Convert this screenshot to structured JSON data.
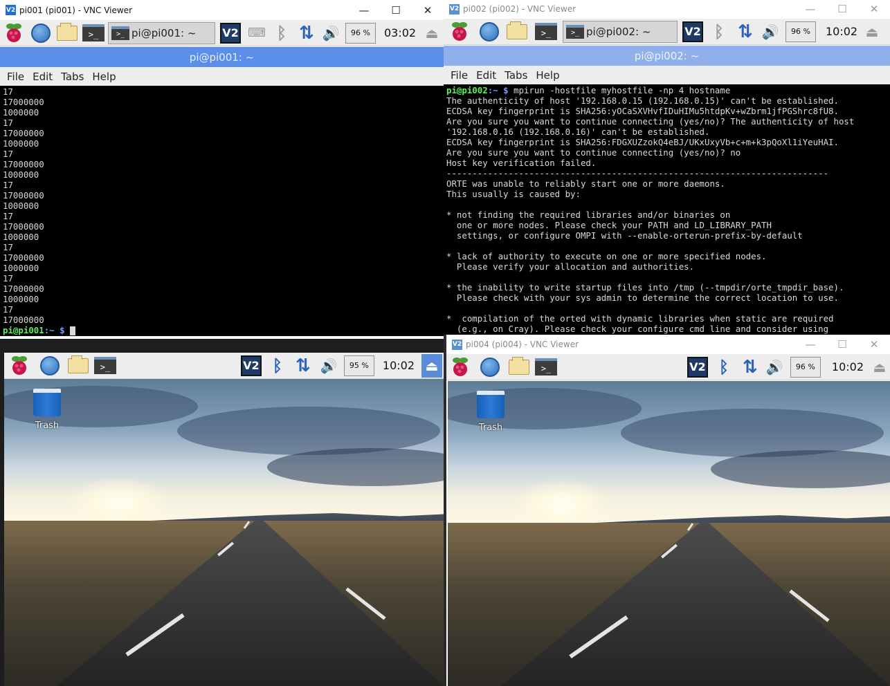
{
  "pi001": {
    "window_title": "pi001 (pi001) - VNC Viewer",
    "taskbar_label": "pi@pi001: ~",
    "cpu": "96 %",
    "clock": "03:02",
    "term_title": "pi@pi001: ~",
    "menu": [
      "File",
      "Edit",
      "Tabs",
      "Help"
    ],
    "lines": [
      "17",
      "17000000",
      "1000000",
      "17",
      "17000000",
      "1000000",
      "17",
      "17000000",
      "1000000",
      "17",
      "17000000",
      "1000000",
      "17",
      "17000000",
      "1000000",
      "17",
      "17000000",
      "1000000",
      "17",
      "17000000",
      "1000000",
      "17",
      "17000000"
    ],
    "prompt_user": "pi@pi001",
    "prompt_path": ":~ $ "
  },
  "pi002": {
    "window_title": "pi002 (pi002) - VNC Viewer",
    "taskbar_label": "pi@pi002: ~",
    "cpu": "96 %",
    "clock": "10:02",
    "term_title": "pi@pi002: ~",
    "menu": [
      "File",
      "Edit",
      "Tabs",
      "Help"
    ],
    "prompt_user": "pi@pi002",
    "prompt_path": ":~ $ ",
    "command": "mpirun -hostfile myhostfile -np 4 hostname",
    "lines": [
      "The authenticity of host '192.168.0.15 (192.168.0.15)' can't be established.",
      "ECDSA key fingerprint is SHA256:yOCaSXVHvfIDuHIMu5htdpKv+wZbrm1jfPGShrc8fU8.",
      "Are you sure you want to continue connecting (yes/no)? The authenticity of host",
      "'192.168.0.16 (192.168.0.16)' can't be established.",
      "ECDSA key fingerprint is SHA256:FDGXUZzokQ4eBJ/UKxUxyVb+c+m+k3pQoXl1iYeuHAI.",
      "Are you sure you want to continue connecting (yes/no)? no",
      "Host key verification failed.",
      "--------------------------------------------------------------------------",
      "ORTE was unable to reliably start one or more daemons.",
      "This usually is caused by:",
      "",
      "* not finding the required libraries and/or binaries on",
      "  one or more nodes. Please check your PATH and LD_LIBRARY_PATH",
      "  settings, or configure OMPI with --enable-orterun-prefix-by-default",
      "",
      "* lack of authority to execute on one or more specified nodes.",
      "  Please verify your allocation and authorities.",
      "",
      "* the inability to write startup files into /tmp (--tmpdir/orte_tmpdir_base).",
      "  Please check with your sys admin to determine the correct location to use.",
      "",
      "*  compilation of the orted with dynamic libraries when static are required",
      "  (e.g., on Cray). Please check your configure cmd line and consider using"
    ]
  },
  "pi003": {
    "cpu": "95 %",
    "clock": "10:02",
    "trash_label": "Trash"
  },
  "pi004": {
    "window_title": "pi004 (pi004) - VNC Viewer",
    "cpu": "96 %",
    "clock": "10:02",
    "trash_label": "Trash"
  },
  "icons": {
    "vnc_logo": "V2",
    "terminal": ">_",
    "minimize": "—",
    "maximize": "☐",
    "close": "✕",
    "bluetooth": "ᛒ",
    "network": "⇅",
    "volume": "🔊",
    "eject": "⏏",
    "keyboard": "⌨"
  }
}
